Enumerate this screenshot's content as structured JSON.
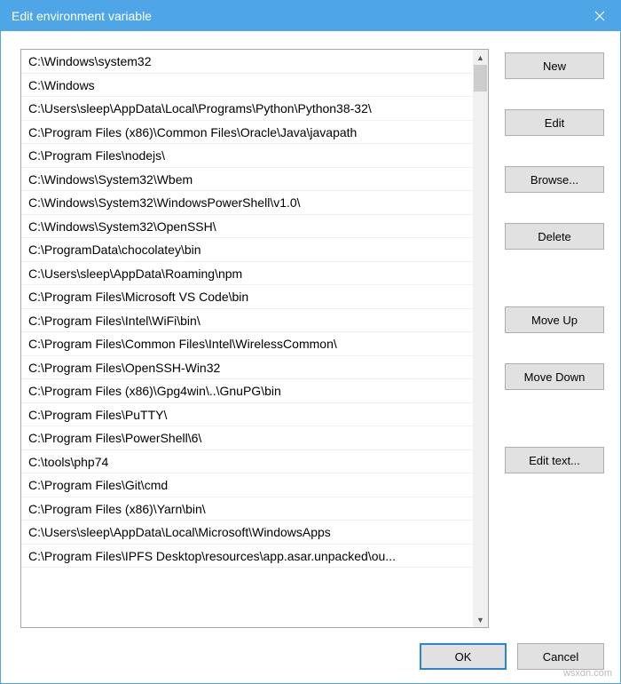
{
  "window": {
    "title": "Edit environment variable"
  },
  "paths": [
    "C:\\Windows\\system32",
    "C:\\Windows",
    "C:\\Users\\sleep\\AppData\\Local\\Programs\\Python\\Python38-32\\",
    "C:\\Program Files (x86)\\Common Files\\Oracle\\Java\\javapath",
    "C:\\Program Files\\nodejs\\",
    "C:\\Windows\\System32\\Wbem",
    "C:\\Windows\\System32\\WindowsPowerShell\\v1.0\\",
    "C:\\Windows\\System32\\OpenSSH\\",
    "C:\\ProgramData\\chocolatey\\bin",
    "C:\\Users\\sleep\\AppData\\Roaming\\npm",
    "C:\\Program Files\\Microsoft VS Code\\bin",
    "C:\\Program Files\\Intel\\WiFi\\bin\\",
    "C:\\Program Files\\Common Files\\Intel\\WirelessCommon\\",
    "C:\\Program Files\\OpenSSH-Win32",
    "C:\\Program Files (x86)\\Gpg4win\\..\\GnuPG\\bin",
    "C:\\Program Files\\PuTTY\\",
    "C:\\Program Files\\PowerShell\\6\\",
    "C:\\tools\\php74",
    "C:\\Program Files\\Git\\cmd",
    "C:\\Program Files (x86)\\Yarn\\bin\\",
    "C:\\Users\\sleep\\AppData\\Local\\Microsoft\\WindowsApps",
    "C:\\Program Files\\IPFS Desktop\\resources\\app.asar.unpacked\\ou..."
  ],
  "buttons": {
    "new": "New",
    "edit": "Edit",
    "browse": "Browse...",
    "delete": "Delete",
    "moveUp": "Move Up",
    "moveDown": "Move Down",
    "editText": "Edit text...",
    "ok": "OK",
    "cancel": "Cancel"
  },
  "watermark": "wsxdn.com"
}
